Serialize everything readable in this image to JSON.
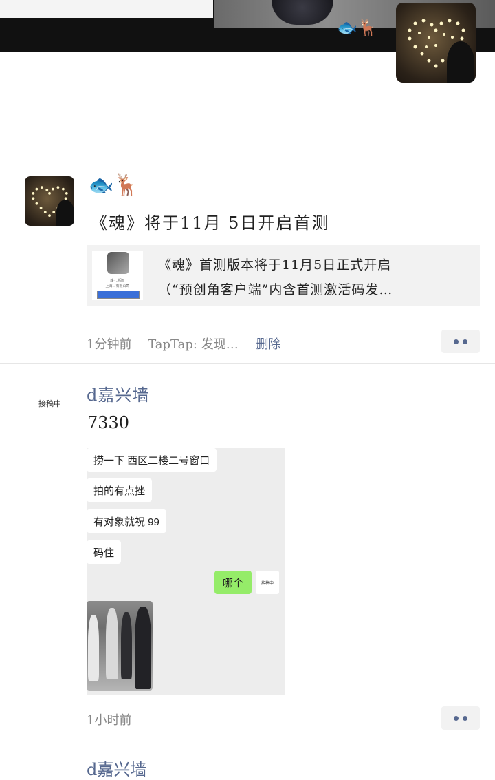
{
  "header": {
    "emoji": "🐟🦌"
  },
  "posts": [
    {
      "name_emoji": "🐟🦌",
      "text": "《魂》将于11月 5日开启首测",
      "link_card": {
        "line1": "《魂》首测版本将于11月5日正式开启",
        "line2": "（“预创角客户端”内含首测激活码发…",
        "thumb_text1": "魂·…相册",
        "thumb_text2": "上海…有限公司"
      },
      "time": "1分钟前",
      "source": "TapTap: 发现…",
      "delete_label": "删除"
    },
    {
      "avatar_label": "接稿中",
      "author": "d嘉兴墙",
      "text": "7330",
      "chat": {
        "messages": [
          "捞一下 西区二楼二号窗口",
          "拍的有点挫",
          "有对象就祝 99",
          "码住"
        ],
        "my_message": "哪个",
        "my_avatar_label": "接稿中"
      },
      "time": "1小时前"
    },
    {
      "author": "d嘉兴墙"
    }
  ],
  "colors": {
    "link_blue": "#56688f",
    "meta_gray": "#888888",
    "wechat_green": "#95ec69"
  }
}
